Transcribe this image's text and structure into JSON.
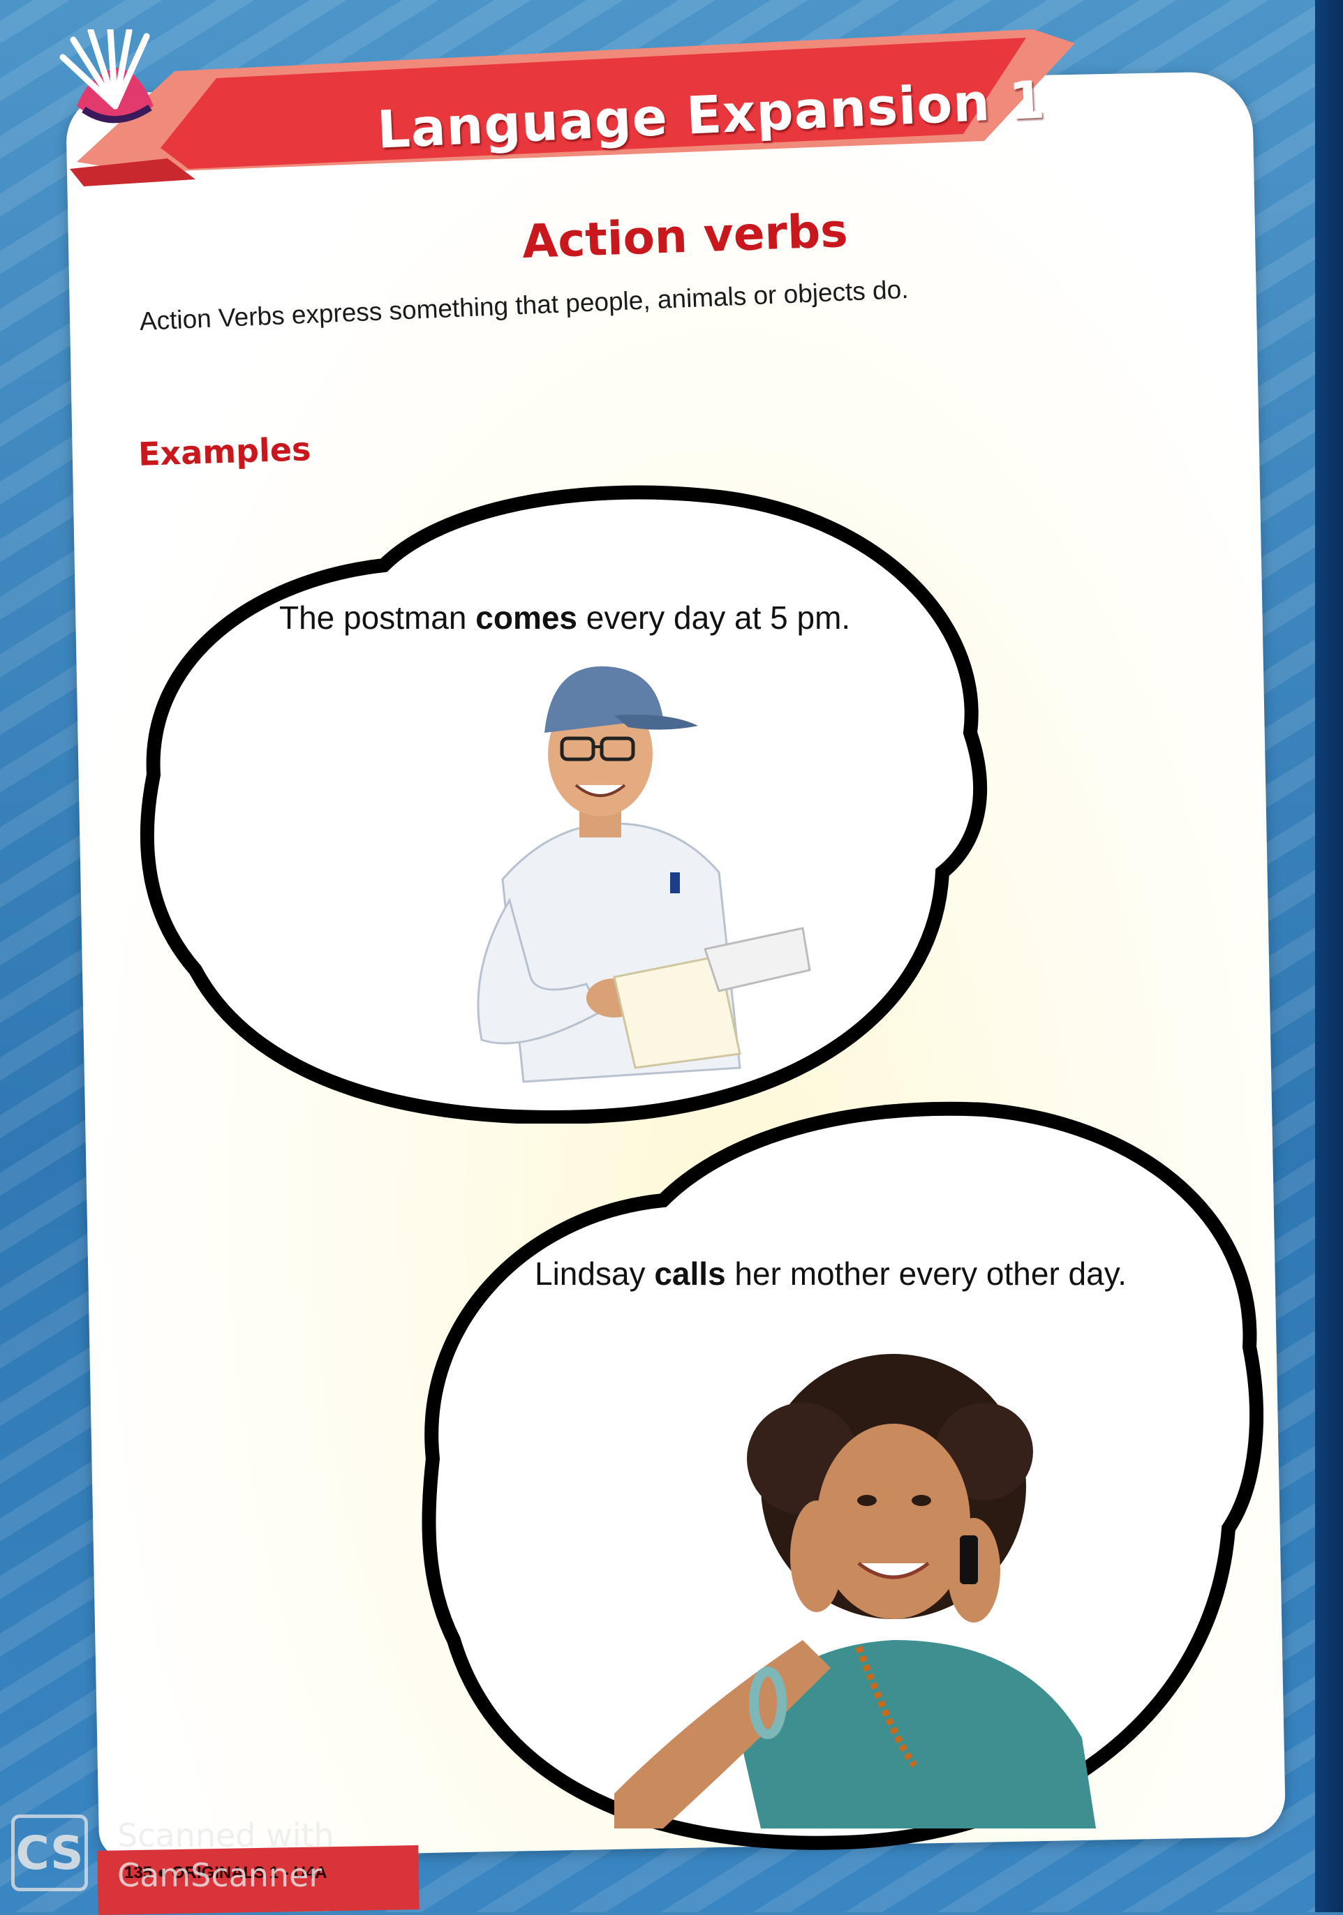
{
  "banner": {
    "title": "Language Expansion 1",
    "colors": {
      "banner_red": "#e8373d",
      "banner_salmon": "#f08a7b",
      "title_text": "#ffffff"
    }
  },
  "content": {
    "heading": "Action verbs",
    "intro": "Action Verbs express something that people, animals or objects do.",
    "examples_label": "Examples",
    "accent_color": "#c8181e"
  },
  "examples": [
    {
      "before": "The postman ",
      "verb": "comes",
      "after": " every day at 5 pm.",
      "image": "postman-delivering-letters"
    },
    {
      "before": "Lindsay ",
      "verb": "calls",
      "after": " her mother every other day.",
      "image": "woman-talking-on-phone"
    }
  ],
  "footer": {
    "text": "135 ● ORIGINALS 1 - U4A"
  },
  "watermark": {
    "logo": "CS",
    "line1": "Scanned with",
    "line2": "CamScanner"
  }
}
